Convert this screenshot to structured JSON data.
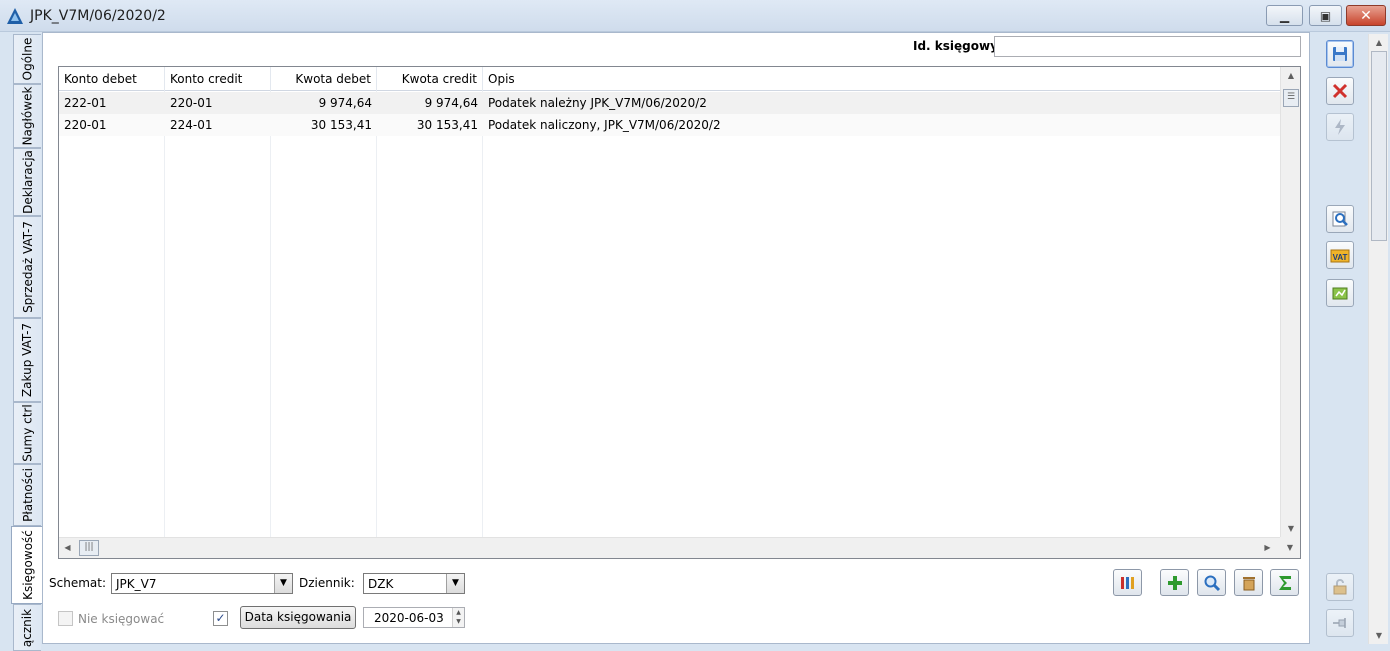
{
  "window": {
    "title": "JPK_V7M/06/2020/2",
    "minimize": "▁",
    "maximize": "▣",
    "close": "✕"
  },
  "left_tabs": [
    "Ogólne",
    "Nagłówek",
    "Deklaracja",
    "Sprzedaż VAT-7",
    "Zakup VAT-7",
    "Sumy ctrl",
    "Płatności",
    "Księgowość",
    "ącznik"
  ],
  "header": {
    "id_label": "Id. księgowy:",
    "id_value": ""
  },
  "grid": {
    "columns": [
      "Konto debet",
      "Konto credit",
      "Kwota debet",
      "Kwota credit",
      "Opis"
    ],
    "rows": [
      [
        "222-01",
        "220-01",
        "9 974,64",
        "9 974,64",
        "Podatek należny JPK_V7M/06/2020/2"
      ],
      [
        "220-01",
        "224-01",
        "30 153,41",
        "30 153,41",
        "Podatek naliczony, JPK_V7M/06/2020/2"
      ]
    ]
  },
  "bottom": {
    "schemat_label": "Schemat:",
    "schemat_value": "JPK_V7",
    "dziennik_label": "Dziennik:",
    "dziennik_value": "DZK",
    "nie_ksiegowac_label": "Nie księgować",
    "data_ksiegowania_label": "Data księgowania",
    "data_ksiegowania_value": "2020-06-03"
  },
  "colors": {
    "accent": "#2b6fbf",
    "window_bg": "#d8e4f1",
    "close_red": "#c8442c"
  }
}
